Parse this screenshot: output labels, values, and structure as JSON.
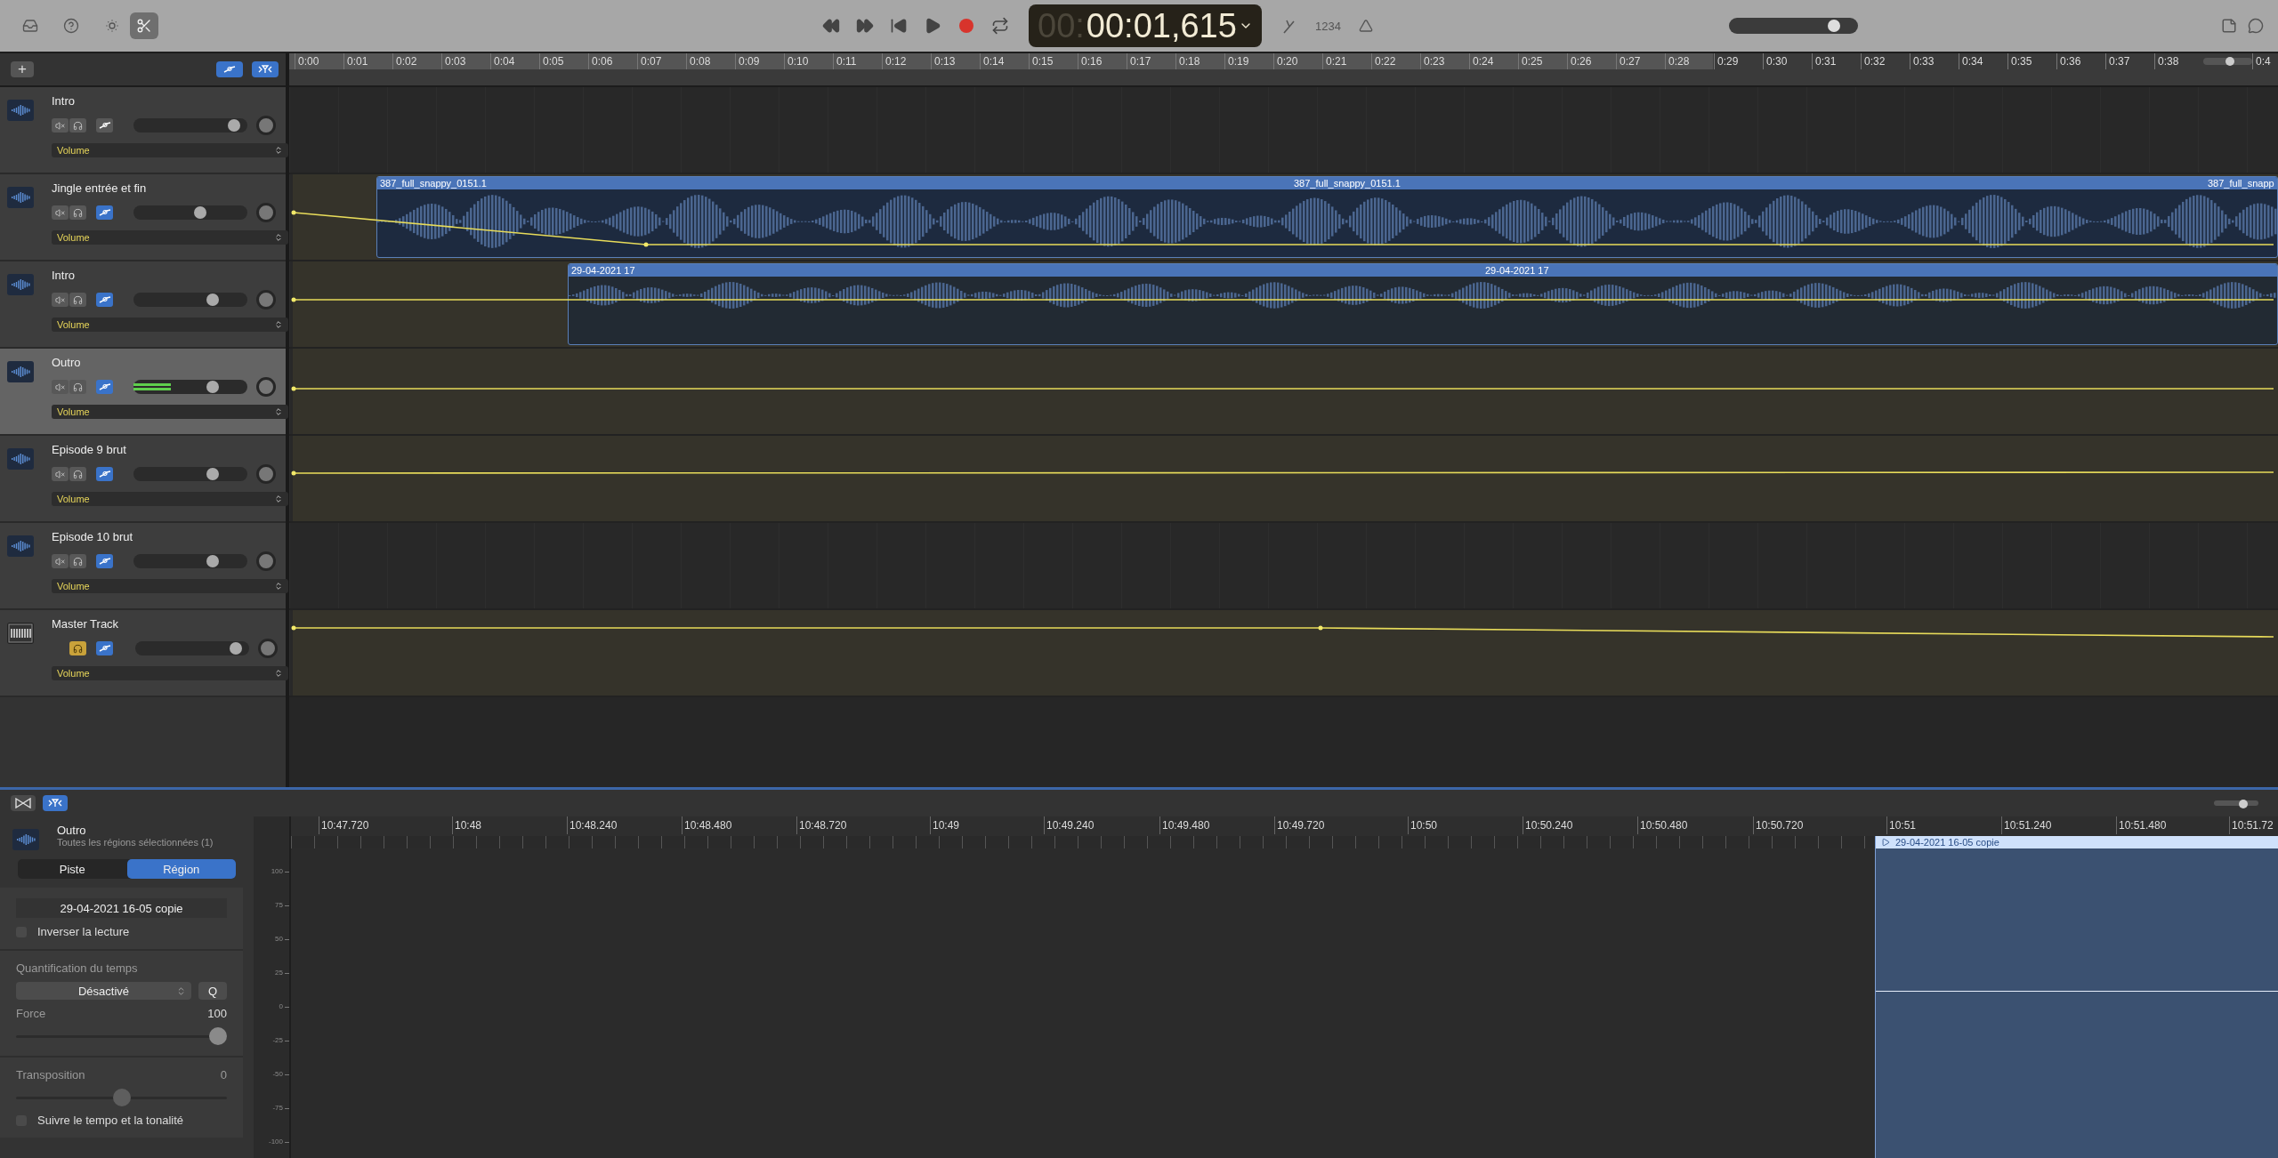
{
  "toolbar": {
    "left_buttons": [
      {
        "kind": "library",
        "selected": false
      },
      {
        "kind": "help",
        "selected": false
      },
      {
        "kind": "smart_controls",
        "selected": false
      },
      {
        "kind": "editors",
        "selected": true
      }
    ],
    "transport": [
      {
        "kind": "rewind"
      },
      {
        "kind": "forward"
      },
      {
        "kind": "to_start"
      },
      {
        "kind": "play"
      },
      {
        "kind": "record"
      },
      {
        "kind": "cycle"
      }
    ],
    "lcd": {
      "dim": "00:",
      "time": "00:01,615"
    },
    "count_in": "1234",
    "master_volume": {
      "level": 0.85
    }
  },
  "track_list": {
    "add_button": "+",
    "automation_on": true,
    "smart_filter_on": true
  },
  "ruler": {
    "labels": [
      "0:00",
      "0:01",
      "0:02",
      "0:03",
      "0:04",
      "0:05",
      "0:06",
      "0:07",
      "0:08",
      "0:09",
      "0:10",
      "0:11",
      "0:12",
      "0:13",
      "0:14",
      "0:15",
      "0:16",
      "0:17",
      "0:18",
      "0:19",
      "0:20",
      "0:21",
      "0:22",
      "0:23",
      "0:24",
      "0:25",
      "0:26",
      "0:27",
      "0:28",
      "0:29",
      "0:30",
      "0:31",
      "0:32",
      "0:33",
      "0:34",
      "0:35",
      "0:36",
      "0:37",
      "0:38"
    ],
    "zoom": {
      "level": 0.55
    },
    "tail": "0:4"
  },
  "tracks": [
    {
      "name": "Intro",
      "kind": "audio",
      "selected": false,
      "automation_on": false,
      "volume": {
        "level": 0.93
      },
      "parameter": "Volume"
    },
    {
      "name": "Jingle entrée et fin",
      "kind": "audio",
      "selected": false,
      "automation_on": true,
      "volume": {
        "level": 0.6
      },
      "parameter": "Volume",
      "region": {
        "labels": [
          "387_full_snappy_0151.1",
          "387_full_snappy_0151.1",
          "387_full_snapp"
        ]
      }
    },
    {
      "name": "Intro",
      "kind": "audio",
      "selected": false,
      "automation_on": true,
      "volume": {
        "level": 0.72
      },
      "parameter": "Volume",
      "region": {
        "labels": [
          "29-04-2021 17",
          "29-04-2021 17"
        ]
      }
    },
    {
      "name": "Outro",
      "kind": "audio",
      "selected": true,
      "automation_on": true,
      "volume": {
        "level": 0.72
      },
      "meter": {
        "level": 0.33
      },
      "parameter": "Volume"
    },
    {
      "name": "Episode 9 brut",
      "kind": "audio",
      "selected": false,
      "automation_on": true,
      "volume": {
        "level": 0.72
      },
      "parameter": "Volume"
    },
    {
      "name": "Episode 10 brut",
      "kind": "audio",
      "selected": false,
      "automation_on": true,
      "volume": {
        "level": 0.72
      },
      "parameter": "Volume"
    },
    {
      "name": "Master Track",
      "kind": "master",
      "selected": false,
      "automation_on": true,
      "volume": {
        "level": 0.93
      },
      "parameter": "Volume"
    }
  ],
  "editor_bar": {
    "buttons": [
      {
        "kind": "bowtie",
        "selected": false
      },
      {
        "kind": "filter",
        "selected": true
      }
    ],
    "zoom": {
      "level": 0.7
    }
  },
  "inspector": {
    "track_name": "Outro",
    "subtitle": "Toutes les régions sélectionnées (1)",
    "tabs": [
      {
        "label": "Piste",
        "selected": false
      },
      {
        "label": "Région",
        "selected": true
      }
    ],
    "region_name": "29-04-2021 16-05 copie",
    "reverse": {
      "label": "Inverser la lecture",
      "checked": false
    },
    "quantize": {
      "heading": "Quantification du temps",
      "value": "Désactivé",
      "button": "Q"
    },
    "force": {
      "label": "Force",
      "reading": "100",
      "level": 1
    },
    "transpose": {
      "label": "Transposition",
      "reading": "0",
      "level": 0.5
    },
    "follow": {
      "label": "Suivre le tempo et la tonalité",
      "checked": false
    }
  },
  "editor": {
    "yticks": [
      "100",
      "75",
      "50",
      "25",
      "0",
      "-25",
      "-50",
      "-75",
      "-100"
    ],
    "ruler": [
      "10:47.720",
      "10:48",
      "10:48.240",
      "10:48.480",
      "10:48.720",
      "10:49",
      "10:49.240",
      "10:49.480",
      "10:49.720",
      "10:50",
      "10:50.240",
      "10:50.480",
      "10:50.720",
      "10:51",
      "10:51.240",
      "10:51.480",
      "10:51.72"
    ],
    "region": {
      "label": "29-04-2021 16-05 copie"
    }
  }
}
